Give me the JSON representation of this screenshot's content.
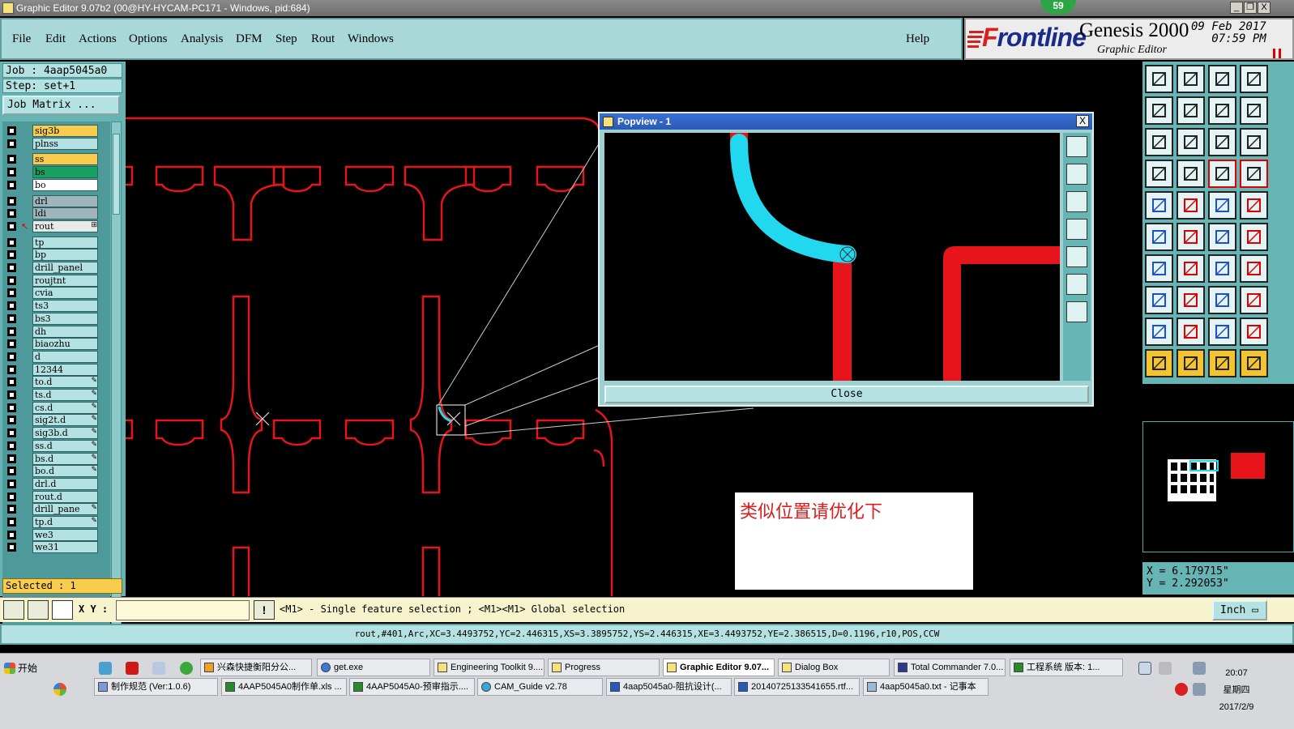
{
  "window": {
    "title": "Graphic Editor 9.07b2 (00@HY-HYCAM-PC171 - Windows, pid:684)",
    "badge": "59",
    "minimize": "_",
    "restore": "❐",
    "close": "X"
  },
  "menu": [
    "File",
    "Edit",
    "Actions",
    "Options",
    "Analysis",
    "DFM",
    "Step",
    "Rout",
    "Windows"
  ],
  "help": "Help",
  "brand": {
    "logo_f": "F",
    "logo_rest": "rontline",
    "product": "Genesis 2000",
    "subtitle": "Graphic Editor",
    "date": "09 Feb 2017",
    "time": "07:59 PM"
  },
  "job": {
    "job_line": "Job : 4aap5045a0",
    "step_line": "Step: set+1",
    "matrix_button": "Job Matrix ..."
  },
  "layers": [
    {
      "name": "sig3b",
      "color": "#f8cc4c",
      "suffix": ""
    },
    {
      "name": "plnss",
      "color": "#b4e2e2",
      "suffix": ""
    },
    {
      "name": "ss",
      "color": "#f8cc4c",
      "suffix": ""
    },
    {
      "name": "bs",
      "color": "#18a060",
      "suffix": ""
    },
    {
      "name": "bo",
      "color": "#ffffff",
      "suffix": ""
    },
    {
      "name": "drl",
      "color": "#a0b4bc",
      "suffix": ""
    },
    {
      "name": "ldi",
      "color": "#a0b4bc",
      "suffix": ""
    },
    {
      "name": "rout",
      "color": "#e8eaea",
      "suffix": "⊞",
      "work": true
    },
    {
      "name": "tp",
      "color": "#b4e2e2",
      "suffix": ""
    },
    {
      "name": "bp",
      "color": "#b4e2e2",
      "suffix": ""
    },
    {
      "name": "drill_panel",
      "color": "#b4e2e2",
      "suffix": ""
    },
    {
      "name": "roujtnt",
      "color": "#b4e2e2",
      "suffix": ""
    },
    {
      "name": "cvia",
      "color": "#b4e2e2",
      "suffix": ""
    },
    {
      "name": "ts3",
      "color": "#b4e2e2",
      "suffix": ""
    },
    {
      "name": "bs3",
      "color": "#b4e2e2",
      "suffix": ""
    },
    {
      "name": "dh",
      "color": "#b4e2e2",
      "suffix": ""
    },
    {
      "name": "biaozhu",
      "color": "#b4e2e2",
      "suffix": ""
    },
    {
      "name": "d",
      "color": "#b4e2e2",
      "suffix": ""
    },
    {
      "name": "12344",
      "color": "#b4e2e2",
      "suffix": ""
    },
    {
      "name": "to.d",
      "color": "#b4e2e2",
      "suffix": "✎"
    },
    {
      "name": "ts.d",
      "color": "#b4e2e2",
      "suffix": "✎"
    },
    {
      "name": "cs.d",
      "color": "#b4e2e2",
      "suffix": "✎"
    },
    {
      "name": "sig2t.d",
      "color": "#b4e2e2",
      "suffix": "✎"
    },
    {
      "name": "sig3b.d",
      "color": "#b4e2e2",
      "suffix": "✎"
    },
    {
      "name": "ss.d",
      "color": "#b4e2e2",
      "suffix": "✎"
    },
    {
      "name": "bs.d",
      "color": "#b4e2e2",
      "suffix": "✎"
    },
    {
      "name": "bo.d",
      "color": "#b4e2e2",
      "suffix": "✎"
    },
    {
      "name": "drl.d",
      "color": "#b4e2e2",
      "suffix": ""
    },
    {
      "name": "rout.d",
      "color": "#b4e2e2",
      "suffix": ""
    },
    {
      "name": "drill_pane",
      "color": "#b4e2e2",
      "suffix": "✎"
    },
    {
      "name": "tp.d",
      "color": "#b4e2e2",
      "suffix": "✎"
    },
    {
      "name": "we3",
      "color": "#b4e2e2",
      "suffix": ""
    },
    {
      "name": "we31",
      "color": "#b4e2e2",
      "suffix": ""
    }
  ],
  "selected": "Selected : 1",
  "popview": {
    "title": "Popview - 1",
    "close_x": "X",
    "close_button": "Close"
  },
  "annotation": "类似位置请优化下",
  "coords": {
    "x": "X = 6.179715\"",
    "y": "Y = 2.292053\""
  },
  "cmd": {
    "xy_label": "X Y :",
    "xy_value": "",
    "warn": "!",
    "hint": "<M1> - Single feature selection ; <M1><M1> Global selection",
    "unit": "Inch"
  },
  "status": "rout,#401,Arc,XC=3.4493752,YC=2.446315,XS=3.3895752,YS=2.446315,XE=3.4493752,YE=2.386515,D=0.1196,r10,POS,CCW",
  "taskbar": {
    "start": "开始",
    "row1": [
      "兴森快捷衡阳分公...",
      "get.exe",
      "Engineering Toolkit 9....",
      "Progress",
      "Graphic Editor 9.07...",
      "Dialog Box",
      "Total Commander 7.0...",
      "工程系统  版本: 1..."
    ],
    "row2": [
      "制作规范 (Ver:1.0.6)",
      "4AAP5045A0制作单.xls ...",
      "4AAP5045A0-预审指示....",
      "CAM_Guide v2.78",
      "4aap5045a0-阻抗设计(...",
      "20140725133541655.rtf...",
      "4aap5045a0.txt - 记事本"
    ],
    "clock_time": "20:07",
    "clock_day": "星期四",
    "clock_date": "2017/2/9"
  }
}
